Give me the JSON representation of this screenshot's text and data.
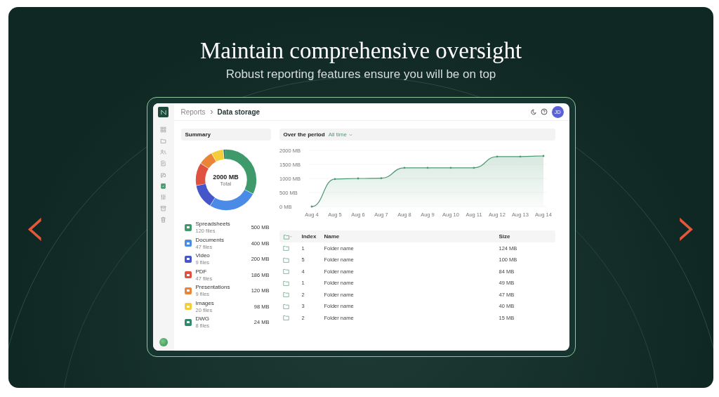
{
  "hero": {
    "title": "Maintain comprehensive oversight",
    "subtitle": "Robust reporting features ensure you will be on top"
  },
  "carousel": {
    "prev": "‹",
    "next": "›"
  },
  "app": {
    "breadcrumb": {
      "parent": "Reports",
      "current": "Data storage"
    },
    "avatar": "JD",
    "sidebar": [
      {
        "kind": "grid",
        "selected": false
      },
      {
        "kind": "folder",
        "selected": false
      },
      {
        "kind": "people",
        "selected": false
      },
      {
        "kind": "document",
        "selected": false
      },
      {
        "kind": "hand",
        "selected": false
      },
      {
        "kind": "clipboard",
        "selected": true
      },
      {
        "kind": "sliders",
        "selected": false
      },
      {
        "kind": "archive",
        "selected": false
      },
      {
        "kind": "trash",
        "selected": false
      }
    ],
    "summary": {
      "title": "Summary",
      "total": "2000 MB",
      "total_label": "Total",
      "items": [
        {
          "name": "Spreadsheets",
          "files": "120 files",
          "size": "500 MB",
          "color": "#3f9a6b"
        },
        {
          "name": "Documents",
          "files": "47 files",
          "size": "400 MB",
          "color": "#4a8be8"
        },
        {
          "name": "Video",
          "files": "9 files",
          "size": "200 MB",
          "color": "#4456c9"
        },
        {
          "name": "PDF",
          "files": "47 files",
          "size": "186 MB",
          "color": "#e0513f"
        },
        {
          "name": "Presentations",
          "files": "9 files",
          "size": "120 MB",
          "color": "#ec8438"
        },
        {
          "name": "Images",
          "files": "20 files",
          "size": "98 MB",
          "color": "#f5cd3a"
        },
        {
          "name": "DWG",
          "files": "8 files",
          "size": "24 MB",
          "color": "#2f8a6e"
        }
      ]
    },
    "period": {
      "label": "Over the period",
      "value": "All time"
    },
    "chart_data": {
      "type": "area",
      "categories": [
        "Aug 4",
        "Aug 5",
        "Aug 6",
        "Aug 7",
        "Aug 8",
        "Aug 9",
        "Aug 10",
        "Aug 11",
        "Aug 12",
        "Aug 13",
        "Aug 14"
      ],
      "series": [
        {
          "color": "#4c9a72",
          "values": [
            0,
            980,
            1000,
            1010,
            1380,
            1380,
            1380,
            1380,
            1780,
            1780,
            1800
          ]
        }
      ],
      "ylim": [
        0,
        2000
      ],
      "yticks": [
        {
          "value": 0,
          "label": "0 MB"
        },
        {
          "value": 500,
          "label": "500 MB"
        },
        {
          "value": 1000,
          "label": "1000 MB"
        },
        {
          "value": 1500,
          "label": "1500 MB"
        },
        {
          "value": 2000,
          "label": "2000 MB"
        }
      ]
    },
    "table": {
      "columns": [
        "Index",
        "Name",
        "Size"
      ],
      "rows": [
        {
          "index": "1",
          "name": "Folder name",
          "size": "124 MB"
        },
        {
          "index": "5",
          "name": "Folder name",
          "size": "100 MB"
        },
        {
          "index": "4",
          "name": "Folder name",
          "size": "84 MB"
        },
        {
          "index": "1",
          "name": "Folder name",
          "size": "49 MB"
        },
        {
          "index": "2",
          "name": "Folder name",
          "size": "47 MB"
        },
        {
          "index": "3",
          "name": "Folder name",
          "size": "40 MB"
        },
        {
          "index": "2",
          "name": "Folder name",
          "size": "15 MB"
        }
      ]
    }
  }
}
